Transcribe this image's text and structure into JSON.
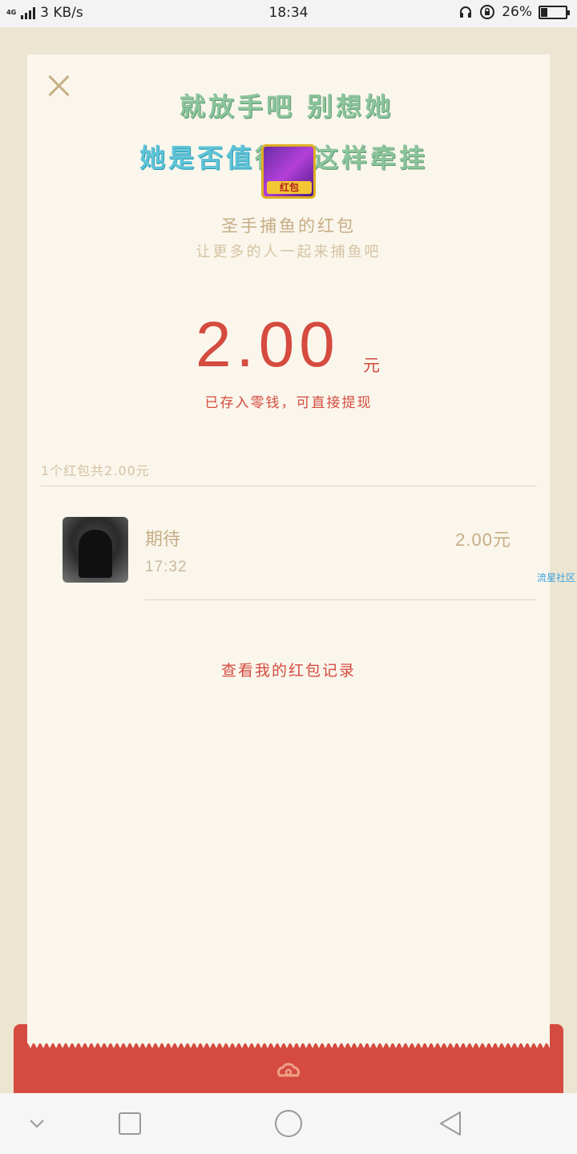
{
  "status_bar": {
    "network": "4G",
    "speed": "3 KB/s",
    "time": "18:34",
    "battery": "26%",
    "battery_level": 0.26
  },
  "envelope": {
    "sender_name_line1": "就放手吧 别想她",
    "sender_name_line2_a": "她是否值",
    "sender_name_line2_b": "得你这样牵挂",
    "sender_avatar_badge": "红包",
    "title": "圣手捕鱼的红包",
    "subtitle": "让更多的人一起来捕鱼吧",
    "amount": "2.00",
    "amount_unit": "元",
    "note": "已存入零钱，可直接提现"
  },
  "summary": "1个红包共2.00元",
  "receivers": [
    {
      "name": "期待",
      "time": "17:32",
      "amount": "2.00元"
    }
  ],
  "watermark": "流星社区",
  "record_link": "查看我的红包记录",
  "colors": {
    "accent_red": "#d54b3f",
    "gold": "#c7ad86",
    "card_bg": "#faf6ec",
    "backdrop": "#ece5d2"
  },
  "icons": {
    "close": "close-icon",
    "nav_back": "triangle-back-icon",
    "nav_home": "circle-home-icon",
    "nav_recent": "square-recent-icon",
    "nav_hide": "chevron-down-icon"
  }
}
